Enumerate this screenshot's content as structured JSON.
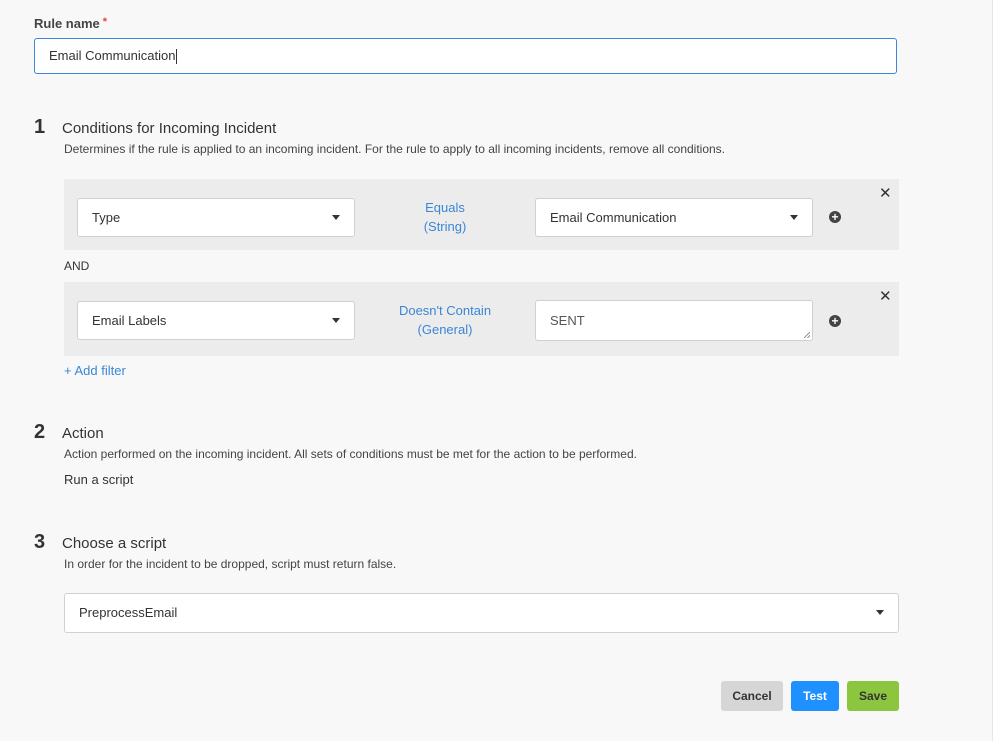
{
  "rule_name": {
    "label": "Rule name",
    "required_mark": "*",
    "value": "Email Communication"
  },
  "step1": {
    "number": "1",
    "title": "Conditions for Incoming Incident",
    "description": "Determines if the rule is applied to an incoming incident. For the rule to apply to all incoming incidents, remove all conditions.",
    "conditions": [
      {
        "field": "Type",
        "operator_line1": "Equals",
        "operator_line2": "(String)",
        "value": "Email Communication",
        "value_kind": "select"
      },
      {
        "field": "Email Labels",
        "operator_line1": "Doesn't Contain",
        "operator_line2": "(General)",
        "value": "SENT",
        "value_kind": "text"
      }
    ],
    "joiner": "AND",
    "add_filter": "+ Add filter"
  },
  "step2": {
    "number": "2",
    "title": "Action",
    "description": "Action performed on the incoming incident. All sets of conditions must be met for the action to be performed.",
    "action_value": "Run a script"
  },
  "step3": {
    "number": "3",
    "title": "Choose a script",
    "description": "In order for the incident to be dropped, script must return false.",
    "script_value": "PreprocessEmail"
  },
  "buttons": {
    "cancel": "Cancel",
    "test": "Test",
    "save": "Save"
  },
  "colors": {
    "accent": "#3b86d6",
    "test_button": "#1e90ff",
    "save_button": "#8cc63f",
    "cancel_button": "#d6d6d6",
    "required": "#e4423c"
  },
  "icons": {
    "dropdown": "chevron-down-icon",
    "add_condition": "plus-circle-icon",
    "remove_condition": "close-icon"
  }
}
